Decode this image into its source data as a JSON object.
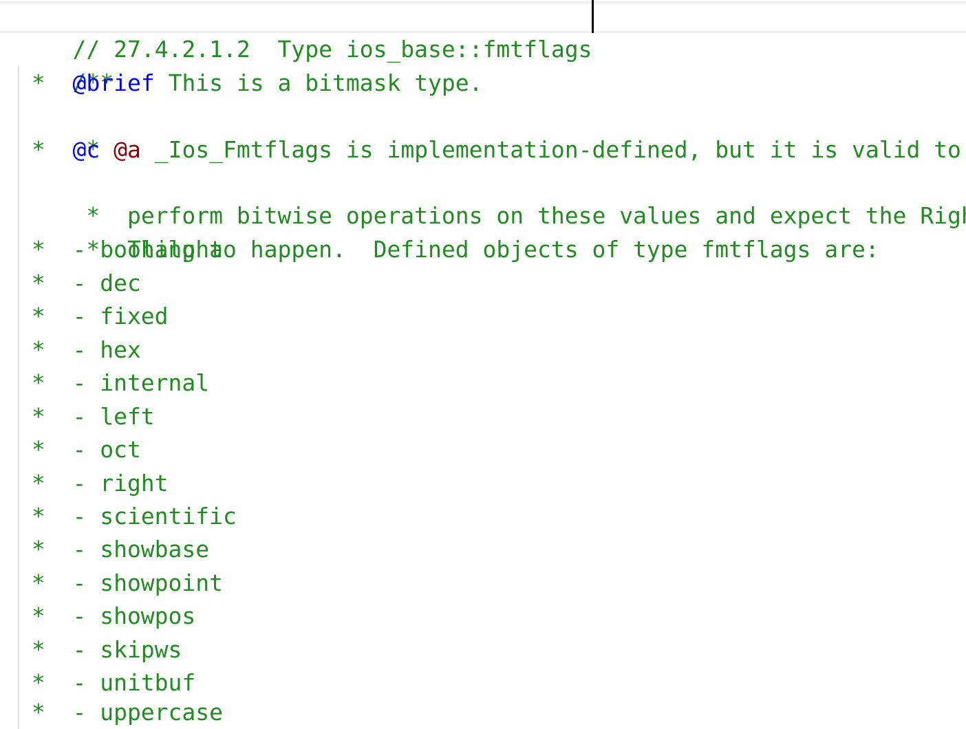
{
  "editor": {
    "line1": "// 27.4.2.1.2  Type ios_base::fmtflags",
    "line2": "/**",
    "brief_prefix": " *  ",
    "brief_tag": "@brief",
    "brief_text": " This is a bitmask type.",
    "blank_star": " *",
    "c_prefix": " *  ",
    "c_tag": "@c",
    "a_tag": "@a",
    "c_text": " _Ios_Fmtflags is implementation-defined, but it is valid to",
    "line6": " *  perform bitwise operations on these values and expect the Right",
    "line7": " *  Thing to happen.  Defined objects of type fmtflags are:",
    "flags": [
      " *  - boolalpha",
      " *  - dec",
      " *  - fixed",
      " *  - hex",
      " *  - internal",
      " *  - left",
      " *  - oct",
      " *  - right",
      " *  - scientific",
      " *  - showbase",
      " *  - showpoint",
      " *  - showpos",
      " *  - skipws",
      " *  - unitbuf",
      " *  - uppercase"
    ]
  },
  "colors": {
    "comment": "#228b22",
    "doc_tag": "#0000ff",
    "doc_tag_alt": "#8b0000"
  }
}
